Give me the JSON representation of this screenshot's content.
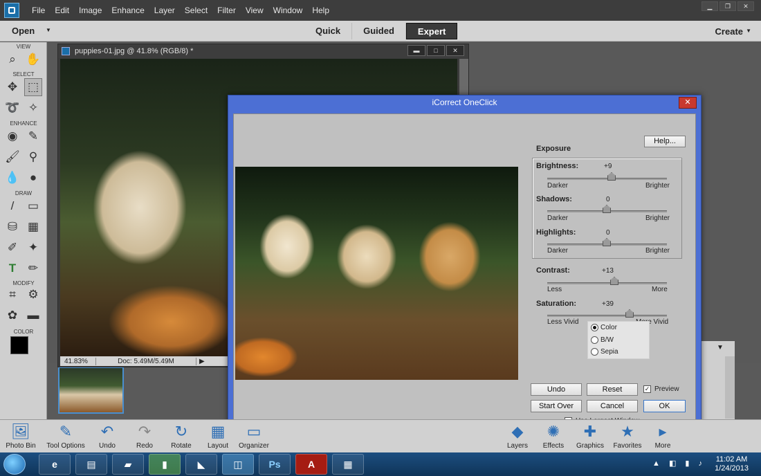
{
  "menubar": {
    "items": [
      "File",
      "Edit",
      "Image",
      "Enhance",
      "Layer",
      "Select",
      "Filter",
      "View",
      "Window",
      "Help"
    ]
  },
  "modebar": {
    "open": "Open",
    "tabs": [
      "Quick",
      "Guided",
      "Expert"
    ],
    "active_tab": "Expert",
    "create": "Create"
  },
  "toolbox": {
    "sections": [
      "VIEW",
      "SELECT",
      "ENHANCE",
      "DRAW",
      "MODIFY",
      "COLOR"
    ]
  },
  "document": {
    "title": "puppies-01.jpg @ 41.8% (RGB/8) *",
    "zoom": "41.83%",
    "doc_size": "Doc: 5.49M/5.49M"
  },
  "dialog": {
    "title": "iCorrect OneClick",
    "exposure_label": "Exposure",
    "help": "Help...",
    "sliders": {
      "brightness": {
        "label": "Brightness:",
        "value": "+9",
        "min": "Darker",
        "max": "Brighter"
      },
      "shadows": {
        "label": "Shadows:",
        "value": "0",
        "min": "Darker",
        "max": "Brighter"
      },
      "highlights": {
        "label": "Highlights:",
        "value": "0",
        "min": "Darker",
        "max": "Brighter"
      },
      "contrast": {
        "label": "Contrast:",
        "value": "+13",
        "min": "Less",
        "max": "More"
      },
      "saturation": {
        "label": "Saturation:",
        "value": "+39",
        "min": "Less Vivid",
        "max": "More Vivid"
      }
    },
    "modes": {
      "color": "Color",
      "bw": "B/W",
      "sepia": "Sepia",
      "selected": "Color"
    },
    "buttons": {
      "undo": "Undo",
      "reset": "Reset",
      "start_over": "Start Over",
      "cancel": "Cancel",
      "ok": "OK"
    },
    "preview": "Preview",
    "preview_checked": true,
    "use_largest_window": "Use Largest Window",
    "use_largest_checked": false
  },
  "taskpane": {
    "left": [
      "Photo Bin",
      "Tool Options",
      "Undo",
      "Redo",
      "Rotate",
      "Layout",
      "Organizer"
    ],
    "right": [
      "Layers",
      "Effects",
      "Graphics",
      "Favorites",
      "More"
    ]
  },
  "taskbar": {
    "apps": [
      "ie",
      "explorer",
      "folder",
      "dreamweaver",
      "notepad",
      "elements",
      "Ps",
      "acrobat",
      "calculator"
    ],
    "time": "11:02 AM",
    "date": "1/24/2013"
  },
  "colors": {
    "accent": "#4c6fd4",
    "close": "#c8392f"
  }
}
